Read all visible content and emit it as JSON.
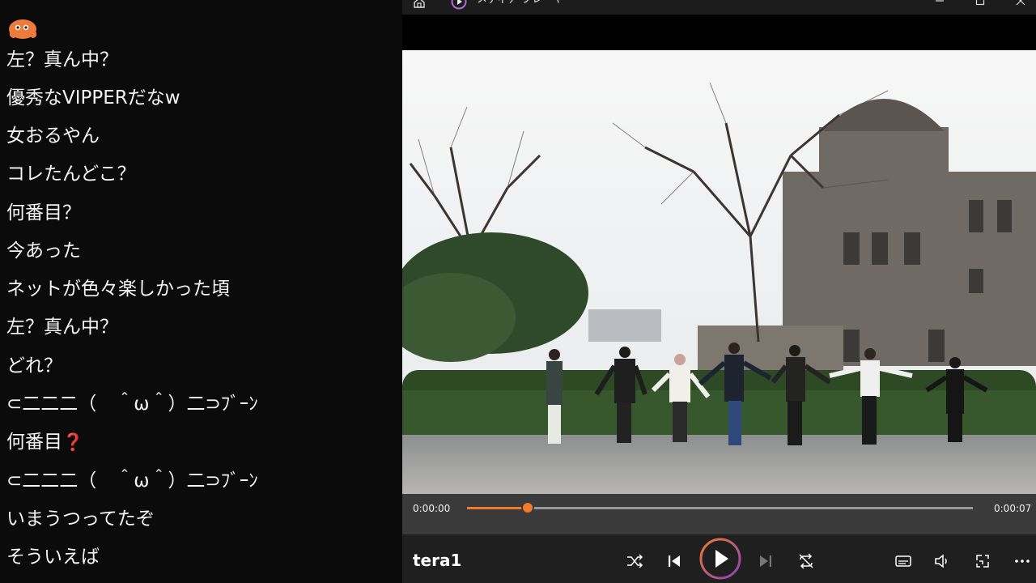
{
  "chat": {
    "messages": [
      {
        "text": "左？真ん中？",
        "emoji": ""
      },
      {
        "text": "優秀なVIPPERだなw",
        "emoji": ""
      },
      {
        "text": "女おるやん",
        "emoji": ""
      },
      {
        "text": "コレたんどこ？",
        "emoji": ""
      },
      {
        "text": "何番目？",
        "emoji": ""
      },
      {
        "text": "今あった",
        "emoji": ""
      },
      {
        "text": "ネットが色々楽しかった頃",
        "emoji": ""
      },
      {
        "text": "左？真ん中？",
        "emoji": ""
      },
      {
        "text": "どれ？",
        "emoji": ""
      },
      {
        "text": "⊂二二二（　＾ω＾）二⊃ﾌﾞｰﾝ",
        "emoji": ""
      },
      {
        "text": "何番目",
        "emoji": "❓"
      },
      {
        "text": "⊂二二二（　＾ω＾）二⊃ﾌﾞｰﾝ",
        "emoji": ""
      },
      {
        "text": "いまうつってたぞ",
        "emoji": ""
      },
      {
        "text": "そういえば",
        "emoji": ""
      }
    ]
  },
  "player": {
    "app_title": "メディア プレーヤー",
    "track_title": "tera1",
    "time_current": "0:00:00",
    "time_total": "0:00:07",
    "progress_fraction": 0.12,
    "is_playing": false,
    "colors": {
      "accent": "#f07b2a",
      "play_ring_start": "#f07b2a",
      "play_ring_end": "#8e3fbf",
      "controls_bg": "#1f1f1f",
      "seek_bg": "#3a3a3a"
    },
    "controls": [
      {
        "name": "shuffle-icon"
      },
      {
        "name": "previous-icon"
      },
      {
        "name": "play-icon"
      },
      {
        "name": "next-icon"
      },
      {
        "name": "repeat-off-icon"
      },
      {
        "name": "captions-icon"
      },
      {
        "name": "volume-icon"
      },
      {
        "name": "miniplayer-icon"
      },
      {
        "name": "more-icon"
      }
    ]
  }
}
